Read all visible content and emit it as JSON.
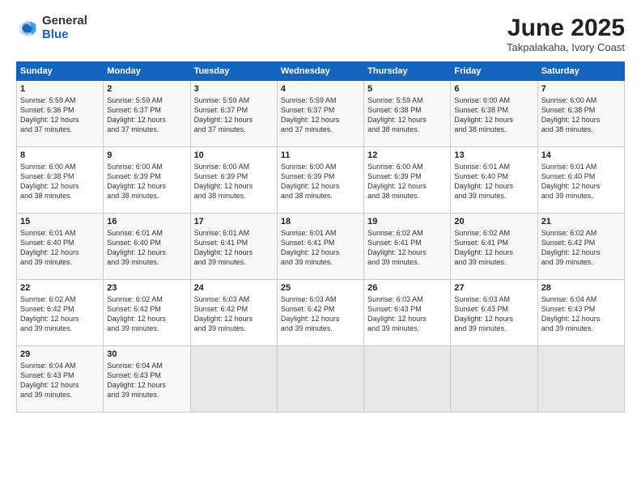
{
  "header": {
    "logo_general": "General",
    "logo_blue": "Blue",
    "month": "June 2025",
    "location": "Takpalakaha, Ivory Coast"
  },
  "days_of_week": [
    "Sunday",
    "Monday",
    "Tuesday",
    "Wednesday",
    "Thursday",
    "Friday",
    "Saturday"
  ],
  "weeks": [
    [
      {
        "day": 1,
        "lines": [
          "Sunrise: 5:59 AM",
          "Sunset: 6:36 PM",
          "Daylight: 12 hours",
          "and 37 minutes."
        ]
      },
      {
        "day": 2,
        "lines": [
          "Sunrise: 5:59 AM",
          "Sunset: 6:37 PM",
          "Daylight: 12 hours",
          "and 37 minutes."
        ]
      },
      {
        "day": 3,
        "lines": [
          "Sunrise: 5:59 AM",
          "Sunset: 6:37 PM",
          "Daylight: 12 hours",
          "and 37 minutes."
        ]
      },
      {
        "day": 4,
        "lines": [
          "Sunrise: 5:59 AM",
          "Sunset: 6:37 PM",
          "Daylight: 12 hours",
          "and 37 minutes."
        ]
      },
      {
        "day": 5,
        "lines": [
          "Sunrise: 5:59 AM",
          "Sunset: 6:38 PM",
          "Daylight: 12 hours",
          "and 38 minutes."
        ]
      },
      {
        "day": 6,
        "lines": [
          "Sunrise: 6:00 AM",
          "Sunset: 6:38 PM",
          "Daylight: 12 hours",
          "and 38 minutes."
        ]
      },
      {
        "day": 7,
        "lines": [
          "Sunrise: 6:00 AM",
          "Sunset: 6:38 PM",
          "Daylight: 12 hours",
          "and 38 minutes."
        ]
      }
    ],
    [
      {
        "day": 8,
        "lines": [
          "Sunrise: 6:00 AM",
          "Sunset: 6:38 PM",
          "Daylight: 12 hours",
          "and 38 minutes."
        ]
      },
      {
        "day": 9,
        "lines": [
          "Sunrise: 6:00 AM",
          "Sunset: 6:39 PM",
          "Daylight: 12 hours",
          "and 38 minutes."
        ]
      },
      {
        "day": 10,
        "lines": [
          "Sunrise: 6:00 AM",
          "Sunset: 6:39 PM",
          "Daylight: 12 hours",
          "and 38 minutes."
        ]
      },
      {
        "day": 11,
        "lines": [
          "Sunrise: 6:00 AM",
          "Sunset: 6:39 PM",
          "Daylight: 12 hours",
          "and 38 minutes."
        ]
      },
      {
        "day": 12,
        "lines": [
          "Sunrise: 6:00 AM",
          "Sunset: 6:39 PM",
          "Daylight: 12 hours",
          "and 38 minutes."
        ]
      },
      {
        "day": 13,
        "lines": [
          "Sunrise: 6:01 AM",
          "Sunset: 6:40 PM",
          "Daylight: 12 hours",
          "and 39 minutes."
        ]
      },
      {
        "day": 14,
        "lines": [
          "Sunrise: 6:01 AM",
          "Sunset: 6:40 PM",
          "Daylight: 12 hours",
          "and 39 minutes."
        ]
      }
    ],
    [
      {
        "day": 15,
        "lines": [
          "Sunrise: 6:01 AM",
          "Sunset: 6:40 PM",
          "Daylight: 12 hours",
          "and 39 minutes."
        ]
      },
      {
        "day": 16,
        "lines": [
          "Sunrise: 6:01 AM",
          "Sunset: 6:40 PM",
          "Daylight: 12 hours",
          "and 39 minutes."
        ]
      },
      {
        "day": 17,
        "lines": [
          "Sunrise: 6:01 AM",
          "Sunset: 6:41 PM",
          "Daylight: 12 hours",
          "and 39 minutes."
        ]
      },
      {
        "day": 18,
        "lines": [
          "Sunrise: 6:01 AM",
          "Sunset: 6:41 PM",
          "Daylight: 12 hours",
          "and 39 minutes."
        ]
      },
      {
        "day": 19,
        "lines": [
          "Sunrise: 6:02 AM",
          "Sunset: 6:41 PM",
          "Daylight: 12 hours",
          "and 39 minutes."
        ]
      },
      {
        "day": 20,
        "lines": [
          "Sunrise: 6:02 AM",
          "Sunset: 6:41 PM",
          "Daylight: 12 hours",
          "and 39 minutes."
        ]
      },
      {
        "day": 21,
        "lines": [
          "Sunrise: 6:02 AM",
          "Sunset: 6:42 PM",
          "Daylight: 12 hours",
          "and 39 minutes."
        ]
      }
    ],
    [
      {
        "day": 22,
        "lines": [
          "Sunrise: 6:02 AM",
          "Sunset: 6:42 PM",
          "Daylight: 12 hours",
          "and 39 minutes."
        ]
      },
      {
        "day": 23,
        "lines": [
          "Sunrise: 6:02 AM",
          "Sunset: 6:42 PM",
          "Daylight: 12 hours",
          "and 39 minutes."
        ]
      },
      {
        "day": 24,
        "lines": [
          "Sunrise: 6:03 AM",
          "Sunset: 6:42 PM",
          "Daylight: 12 hours",
          "and 39 minutes."
        ]
      },
      {
        "day": 25,
        "lines": [
          "Sunrise: 6:03 AM",
          "Sunset: 6:42 PM",
          "Daylight: 12 hours",
          "and 39 minutes."
        ]
      },
      {
        "day": 26,
        "lines": [
          "Sunrise: 6:03 AM",
          "Sunset: 6:43 PM",
          "Daylight: 12 hours",
          "and 39 minutes."
        ]
      },
      {
        "day": 27,
        "lines": [
          "Sunrise: 6:03 AM",
          "Sunset: 6:43 PM",
          "Daylight: 12 hours",
          "and 39 minutes."
        ]
      },
      {
        "day": 28,
        "lines": [
          "Sunrise: 6:04 AM",
          "Sunset: 6:43 PM",
          "Daylight: 12 hours",
          "and 39 minutes."
        ]
      }
    ],
    [
      {
        "day": 29,
        "lines": [
          "Sunrise: 6:04 AM",
          "Sunset: 6:43 PM",
          "Daylight: 12 hours",
          "and 39 minutes."
        ]
      },
      {
        "day": 30,
        "lines": [
          "Sunrise: 6:04 AM",
          "Sunset: 6:43 PM",
          "Daylight: 12 hours",
          "and 39 minutes."
        ]
      },
      {
        "day": null,
        "lines": []
      },
      {
        "day": null,
        "lines": []
      },
      {
        "day": null,
        "lines": []
      },
      {
        "day": null,
        "lines": []
      },
      {
        "day": null,
        "lines": []
      }
    ]
  ]
}
